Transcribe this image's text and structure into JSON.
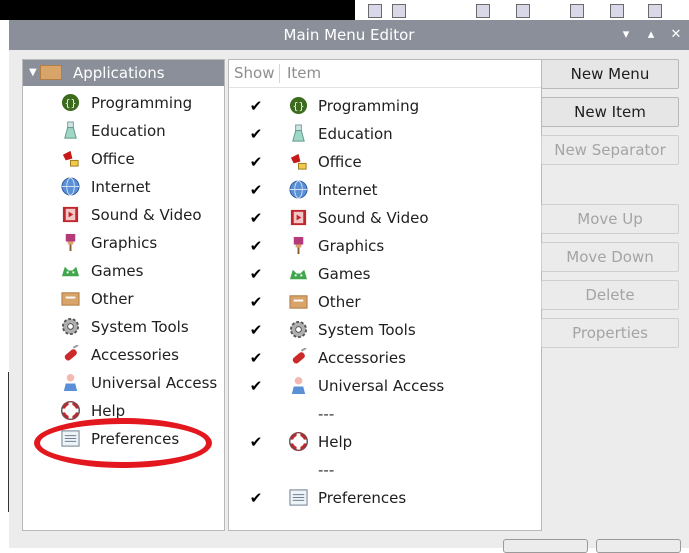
{
  "window": {
    "title": "Main Menu Editor",
    "controls": [
      "▾",
      "▴",
      "✕"
    ]
  },
  "tree": {
    "root_label": "Applications",
    "items": [
      {
        "label": "Programming",
        "icon": "programming-icon"
      },
      {
        "label": "Education",
        "icon": "education-icon"
      },
      {
        "label": "Office",
        "icon": "office-icon"
      },
      {
        "label": "Internet",
        "icon": "internet-icon"
      },
      {
        "label": "Sound & Video",
        "icon": "sound-video-icon"
      },
      {
        "label": "Graphics",
        "icon": "graphics-icon"
      },
      {
        "label": "Games",
        "icon": "games-icon"
      },
      {
        "label": "Other",
        "icon": "other-folder-icon"
      },
      {
        "label": "System Tools",
        "icon": "system-tools-icon"
      },
      {
        "label": "Accessories",
        "icon": "accessories-icon"
      },
      {
        "label": "Universal Access",
        "icon": "universal-access-icon"
      },
      {
        "label": "Help",
        "icon": "help-icon"
      },
      {
        "label": "Preferences",
        "icon": "preferences-icon"
      }
    ]
  },
  "list": {
    "col_show": "Show",
    "col_item": "Item",
    "check_glyph": "✔",
    "rows": [
      {
        "label": "Programming",
        "checked": true
      },
      {
        "label": "Education",
        "checked": true
      },
      {
        "label": "Office",
        "checked": true
      },
      {
        "label": "Internet",
        "checked": true
      },
      {
        "label": "Sound & Video",
        "checked": true
      },
      {
        "label": "Graphics",
        "checked": true
      },
      {
        "label": "Games",
        "checked": true
      },
      {
        "label": "Other",
        "checked": true
      },
      {
        "label": "System Tools",
        "checked": true
      },
      {
        "label": "Accessories",
        "checked": true
      },
      {
        "label": "Universal Access",
        "checked": true
      },
      {
        "label": "---",
        "checked": false
      },
      {
        "label": "Help",
        "checked": true
      },
      {
        "label": "---",
        "checked": false
      },
      {
        "label": "Preferences",
        "checked": true
      }
    ]
  },
  "buttons": {
    "new_menu": "New Menu",
    "new_item": "New Item",
    "new_separator": "New Separator",
    "move_up": "Move Up",
    "move_down": "Move Down",
    "delete": "Delete",
    "properties": "Properties"
  },
  "colors": {
    "titlebar": "#8b8f99",
    "highlight_ring": "#e3171e",
    "disabled_text": "#a4a4a4"
  }
}
